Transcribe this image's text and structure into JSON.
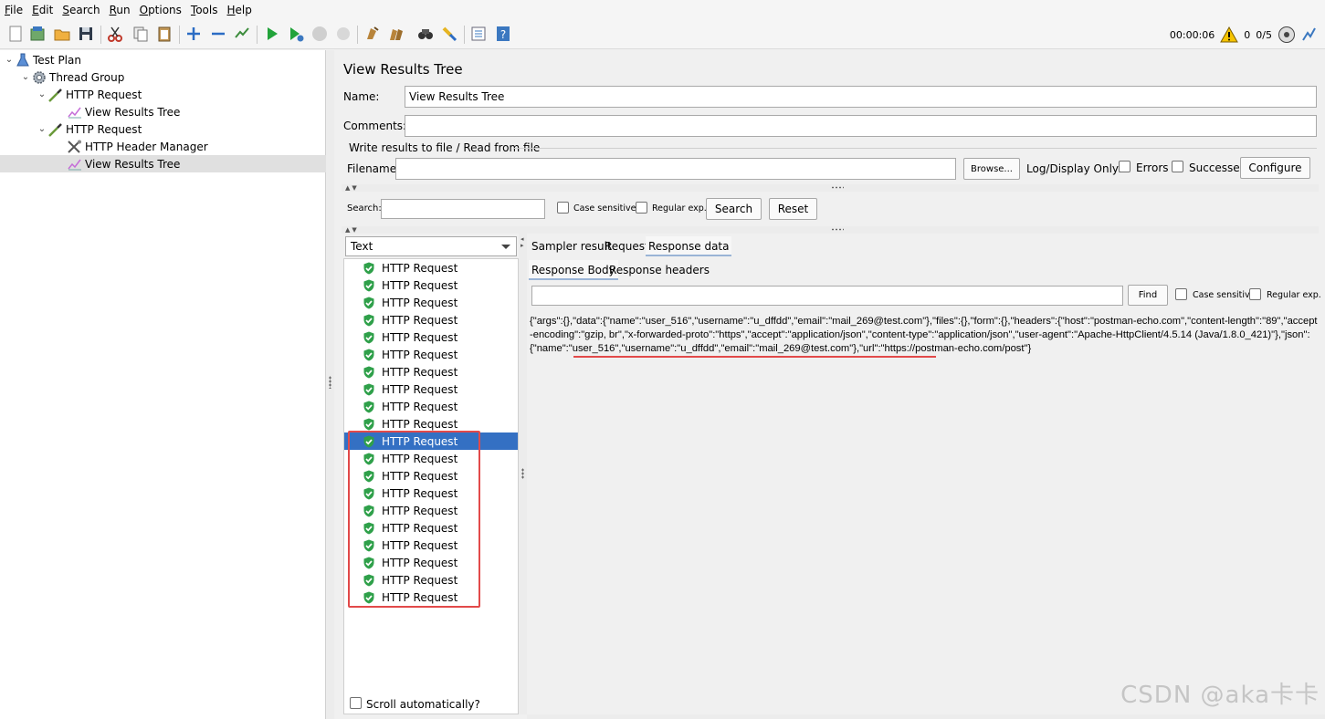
{
  "menu": [
    {
      "label": "File",
      "u": "F"
    },
    {
      "label": "Edit",
      "u": "E"
    },
    {
      "label": "Search",
      "u": "S"
    },
    {
      "label": "Run",
      "u": "R"
    },
    {
      "label": "Options",
      "u": "O"
    },
    {
      "label": "Tools",
      "u": "T"
    },
    {
      "label": "Help",
      "u": "H"
    }
  ],
  "status": {
    "elapsed": "00:00:06",
    "warnings": "0",
    "threads": "0/5"
  },
  "tree": [
    {
      "label": "Test Plan",
      "icon": "flask-icon"
    },
    {
      "label": "Thread Group",
      "icon": "gear-icon"
    },
    {
      "label": "HTTP Request",
      "icon": "pipette-icon"
    },
    {
      "label": "View Results Tree",
      "icon": "chart-icon"
    },
    {
      "label": "HTTP Request",
      "icon": "pipette-icon"
    },
    {
      "label": "HTTP Header Manager",
      "icon": "wrench-icon"
    },
    {
      "label": "View Results Tree",
      "icon": "chart-icon"
    }
  ],
  "panel": {
    "title": "View Results Tree",
    "name_label": "Name:",
    "name_value": "View Results Tree",
    "comments_label": "Comments:",
    "comments_value": "",
    "write_results": "Write results to file / Read from file",
    "filename_label": "Filename",
    "filename_value": "",
    "browse": "Browse...",
    "log_display": "Log/Display Only:",
    "errors": "Errors",
    "successes": "Successes",
    "configure": "Configure",
    "search_label": "Search:",
    "search_value": "",
    "case_sensitive": "Case sensitive",
    "regular_exp": "Regular exp.",
    "search_btn": "Search",
    "reset_btn": "Reset"
  },
  "renderer": "Text",
  "results": [
    "HTTP Request",
    "HTTP Request",
    "HTTP Request",
    "HTTP Request",
    "HTTP Request",
    "HTTP Request",
    "HTTP Request",
    "HTTP Request",
    "HTTP Request",
    "HTTP Request",
    "HTTP Request",
    "HTTP Request",
    "HTTP Request",
    "HTTP Request",
    "HTTP Request",
    "HTTP Request",
    "HTTP Request",
    "HTTP Request",
    "HTTP Request",
    "HTTP Request"
  ],
  "selected_result": 10,
  "scroll_auto": "Scroll automatically?",
  "tabs": [
    "Sampler result",
    "Request",
    "Response data"
  ],
  "subtabs": [
    "Response Body",
    "Response headers"
  ],
  "find": {
    "value": "",
    "button": "Find",
    "case_sensitive": "Case sensitive",
    "regular_exp": "Regular exp."
  },
  "response": {
    "pre": "{\"args\":{},\"data\":{\"name\":\"user_516\",\"username\":\"u_dffdd\",\"email\":\"mail_269@test.com\"},\"files\":{},\"form\":{},\"headers\":{\"host\":\"postman-echo.com\",\"content-length\":\"89\",\"accept-encoding\":\"gzip, br\",\"x-forwarded-proto\":\"https\",\"accept\":\"application/json\",\"content-type\":\"application/json\",\"user-agent\":\"Apache-HttpClient/4.5.14 (Java/1.8.0_421)\"},",
    "hl": "\"json\":{\"name\":\"user_516\",\"username\":\"u_dffdd\",\"email\":\"mail_269@test.com\"",
    "post": "},\"url\":\"https://postman-echo.com/post\"}"
  },
  "watermark": "CSDN @aka卡卡"
}
